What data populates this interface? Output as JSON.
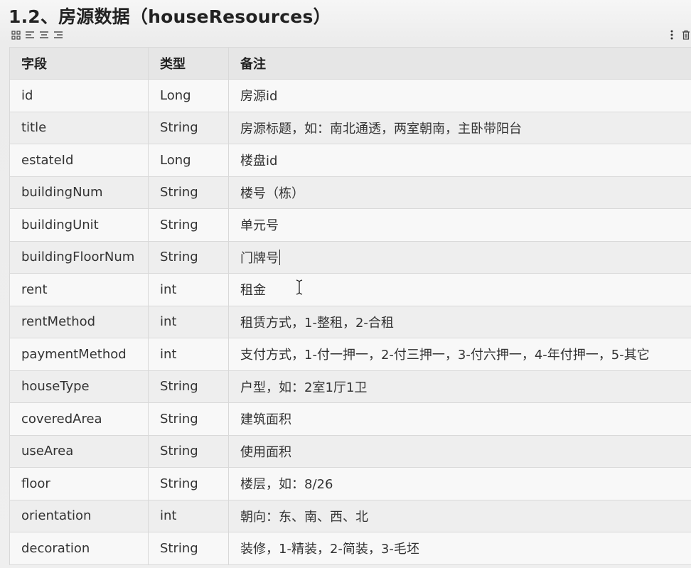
{
  "heading": "1.2、房源数据（houseResources）",
  "toolbar": {
    "left_icons": [
      "grid-icon",
      "align-left-icon",
      "align-center-icon",
      "align-right-icon"
    ],
    "right_icons": [
      "more-vertical-icon",
      "trash-icon"
    ]
  },
  "table": {
    "headers": [
      "字段",
      "类型",
      "备注"
    ],
    "rows": [
      {
        "field": "id",
        "type": "Long",
        "note": "房源id"
      },
      {
        "field": "title",
        "type": "String",
        "note": "房源标题，如：南北通透，两室朝南，主卧带阳台"
      },
      {
        "field": "estateId",
        "type": "Long",
        "note": "楼盘id"
      },
      {
        "field": "buildingNum",
        "type": "String",
        "note": "楼号（栋）"
      },
      {
        "field": "buildingUnit",
        "type": "String",
        "note": "单元号"
      },
      {
        "field": "buildingFloorNum",
        "type": "String",
        "note": "门牌号"
      },
      {
        "field": "rent",
        "type": "int",
        "note": "租金"
      },
      {
        "field": "rentMethod",
        "type": "int",
        "note": "租赁方式，1-整租，2-合租"
      },
      {
        "field": "paymentMethod",
        "type": "int",
        "note": "支付方式，1-付一押一，2-付三押一，3-付六押一，4-年付押一，5-其它"
      },
      {
        "field": "houseType",
        "type": "String",
        "note": "户型，如：2室1厅1卫"
      },
      {
        "field": "coveredArea",
        "type": "String",
        "note": "建筑面积"
      },
      {
        "field": "useArea",
        "type": "String",
        "note": "使用面积"
      },
      {
        "field": "floor",
        "type": "String",
        "note": "楼层，如：8/26"
      },
      {
        "field": "orientation",
        "type": "int",
        "note": "朝向：东、南、西、北"
      },
      {
        "field": "decoration",
        "type": "String",
        "note": "装修，1-精装，2-简装，3-毛坯"
      }
    ]
  }
}
